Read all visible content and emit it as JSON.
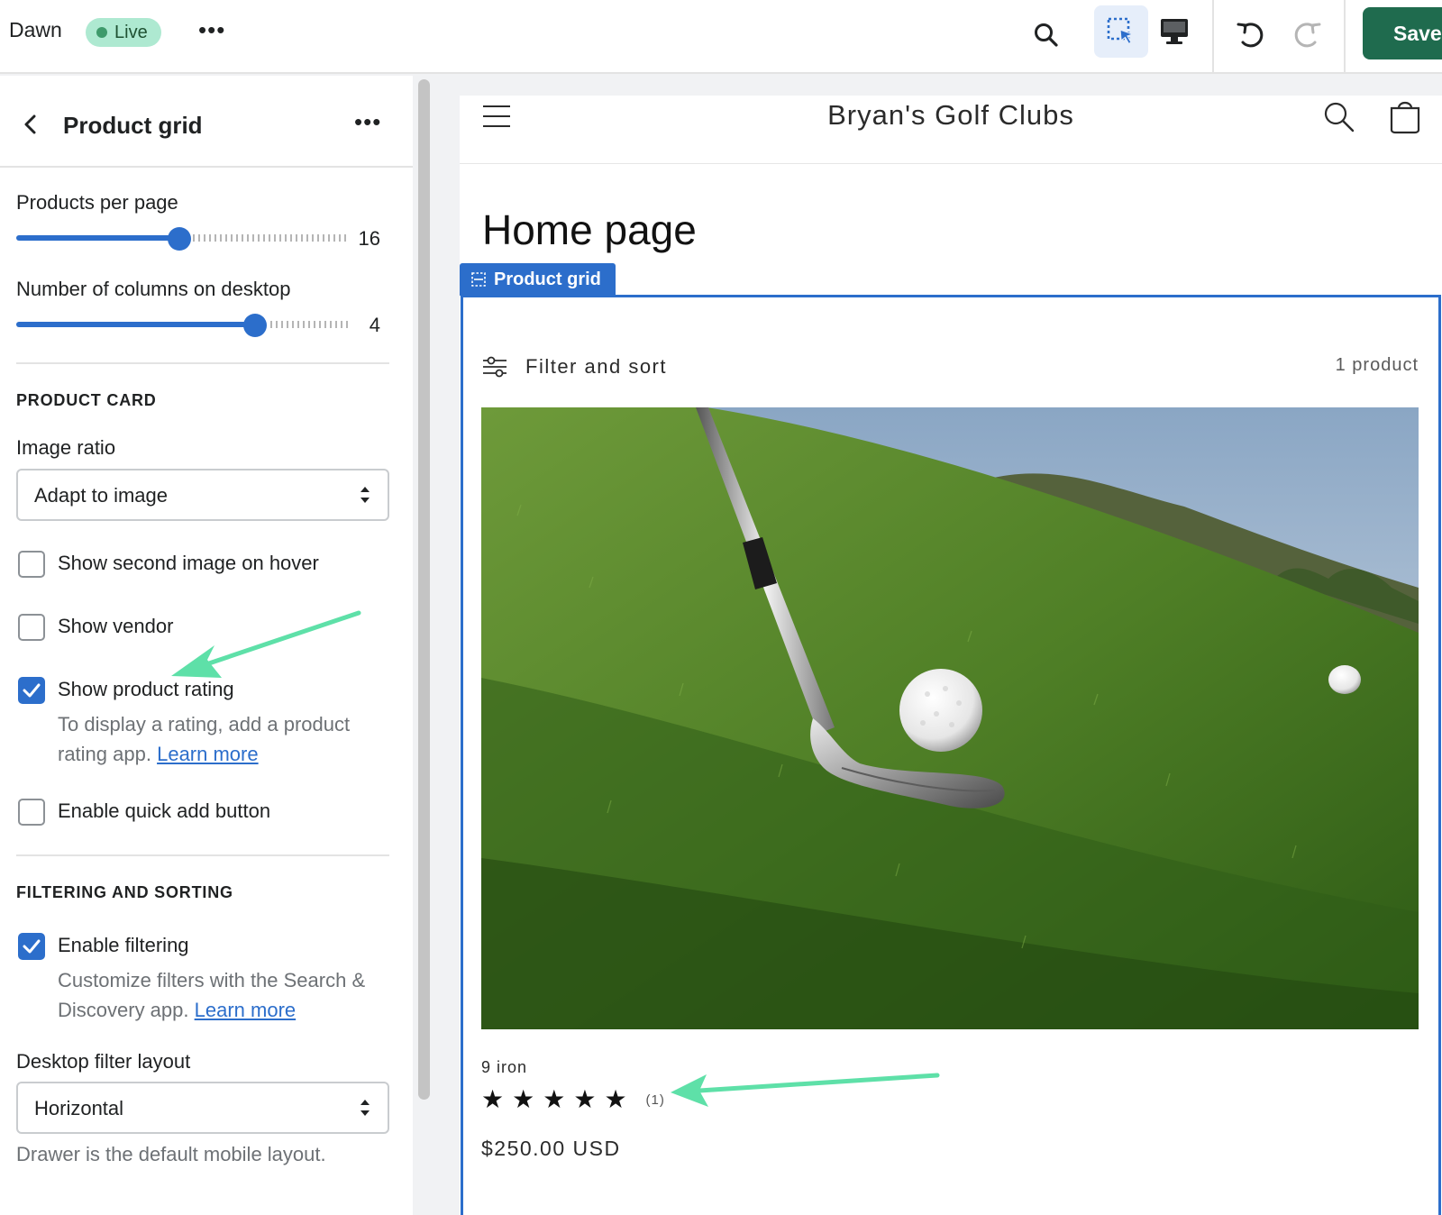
{
  "topbar": {
    "theme_name": "Dawn",
    "status_badge": "Live",
    "save_label": "Save",
    "icons": [
      "more-icon",
      "search-icon",
      "inspector-select-icon",
      "desktop-view-icon",
      "undo-icon",
      "redo-icon"
    ]
  },
  "sidebar": {
    "title": "Product grid",
    "products_per_page": {
      "label": "Products per page",
      "value": "16",
      "fraction": 0.5
    },
    "columns_desktop": {
      "label": "Number of columns on desktop",
      "value": "4",
      "fraction": 0.73
    },
    "product_card": {
      "heading": "PRODUCT CARD",
      "image_ratio_label": "Image ratio",
      "image_ratio_value": "Adapt to image",
      "show_second_image": {
        "label": "Show second image on hover",
        "checked": false
      },
      "show_vendor": {
        "label": "Show vendor",
        "checked": false
      },
      "show_rating": {
        "label": "Show product rating",
        "checked": true,
        "help": "To display a rating, add a product rating app.",
        "link": "Learn more"
      },
      "quick_add": {
        "label": "Enable quick add button",
        "checked": false
      }
    },
    "filtering": {
      "heading": "FILTERING AND SORTING",
      "enable_filtering": {
        "label": "Enable filtering",
        "checked": true,
        "help": "Customize filters with the Search & Discovery app.",
        "link": "Learn more"
      },
      "desktop_layout_label": "Desktop filter layout",
      "desktop_layout_value": "Horizontal",
      "footer_note": "Drawer is the default mobile layout."
    }
  },
  "preview": {
    "store_name": "Bryan's Golf Clubs",
    "page_title": "Home page",
    "section_tag": "Product grid",
    "filter_label": "Filter and sort",
    "product_count": "1 product",
    "product": {
      "title": "9 iron",
      "rating": 5,
      "rating_count": "(1)",
      "price": "$250.00 USD"
    }
  },
  "colors": {
    "accent_blue": "#2c6ecb",
    "save_green": "#1f6b4e",
    "live_badge": "#aee9d1",
    "annotation_arrow": "#5ee0a8"
  }
}
